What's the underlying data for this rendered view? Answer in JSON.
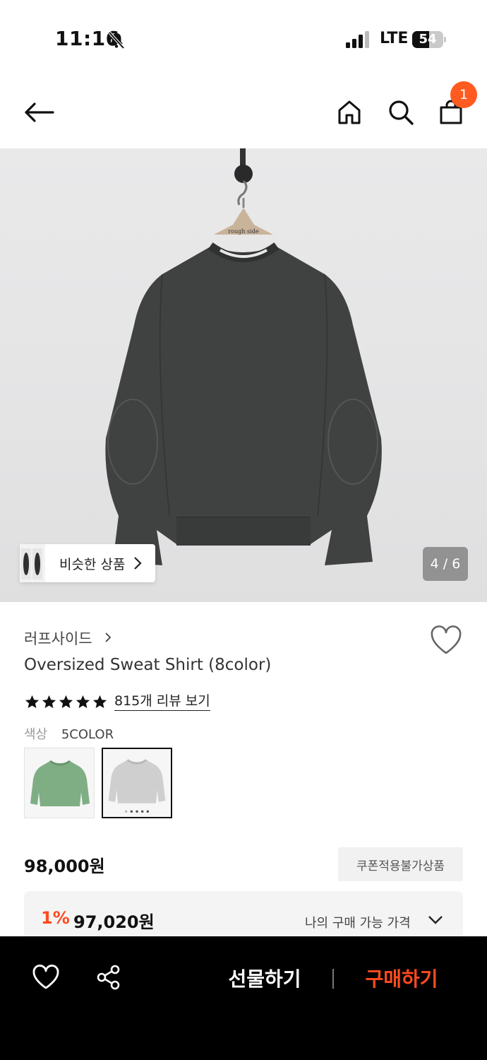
{
  "status_bar": {
    "time": "11:16",
    "network": "LTE",
    "battery_level": "54",
    "battery_percent": 54
  },
  "nav": {
    "icons": [
      "back-arrow-icon",
      "home-icon",
      "search-icon",
      "shopping-bag-icon"
    ],
    "cart_count": "1",
    "badge_color": "#ff5a1f"
  },
  "gallery": {
    "similar_label": "비슷한 상품",
    "page_indicator": "4 / 6",
    "hanger_tag": "rough side"
  },
  "product": {
    "brand": "러프사이드",
    "name": "Oversized Sweat Shirt (8color)",
    "stars": 5,
    "review_link": "815개 리뷰 보기",
    "color_label": "색상",
    "color_value": "5COLOR",
    "swatches": [
      "green-sweatshirt",
      "grey-sweatshirt"
    ],
    "price": "98,000원",
    "coupon_tag": "쿠폰적용불가상품",
    "discount_rate": "1%",
    "my_price": "97,020원",
    "my_price_label": "나의 구매 가능 가격"
  },
  "bottom_bar": {
    "gift_label": "선물하기",
    "buy_label": "구매하기",
    "accent_color": "#ff4b1f"
  }
}
